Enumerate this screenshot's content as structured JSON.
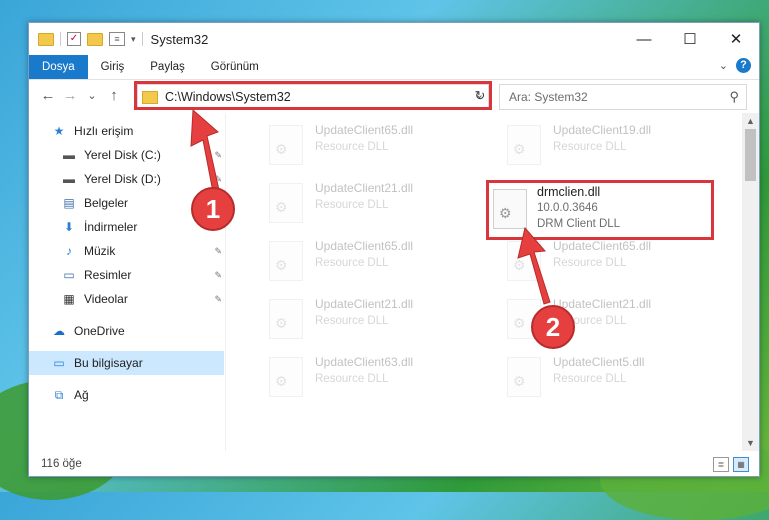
{
  "window": {
    "title": "System32"
  },
  "window_controls": {
    "minimize": "—",
    "maximize": "☐",
    "close": "✕"
  },
  "ribbon": {
    "tabs": [
      "Dosya",
      "Giriş",
      "Paylaş",
      "Görünüm"
    ],
    "active_tab": "Dosya",
    "help": "?"
  },
  "navigation": {
    "back": "←",
    "forward": "→",
    "recent": "⌄",
    "up": "↑",
    "address": "C:\\Windows\\System32",
    "refresh": "↻",
    "search_placeholder": "Ara: System32"
  },
  "sidebar": {
    "items": [
      {
        "label": "Hızlı erişim",
        "icon": "star-icon",
        "glyph": "★",
        "color": "#2b7fd4",
        "pinned": false,
        "selected": false
      },
      {
        "label": "Yerel Disk (C:)",
        "icon": "drive-icon",
        "glyph": "▬",
        "color": "#555555",
        "pinned": true,
        "selected": false
      },
      {
        "label": "Yerel Disk (D:)",
        "icon": "drive-icon",
        "glyph": "▬",
        "color": "#555555",
        "pinned": true,
        "selected": false
      },
      {
        "label": "Belgeler",
        "icon": "documents-icon",
        "glyph": "▤",
        "color": "#3a6ea5",
        "pinned": true,
        "selected": false
      },
      {
        "label": "İndirmeler",
        "icon": "downloads-icon",
        "glyph": "⬇",
        "color": "#2b7fd4",
        "pinned": true,
        "selected": false
      },
      {
        "label": "Müzik",
        "icon": "music-icon",
        "glyph": "♪",
        "color": "#2b7fd4",
        "pinned": true,
        "selected": false
      },
      {
        "label": "Resimler",
        "icon": "pictures-icon",
        "glyph": "▭",
        "color": "#3a6ea5",
        "pinned": true,
        "selected": false
      },
      {
        "label": "Videolar",
        "icon": "videos-icon",
        "glyph": "▦",
        "color": "#333333",
        "pinned": true,
        "selected": false
      },
      {
        "label": "OneDrive",
        "icon": "onedrive-icon",
        "glyph": "☁",
        "color": "#1a6fc9",
        "pinned": false,
        "selected": false
      },
      {
        "label": "Bu bilgisayar",
        "icon": "computer-icon",
        "glyph": "▭",
        "color": "#2b7fd4",
        "pinned": false,
        "selected": true
      },
      {
        "label": "Ağ",
        "icon": "network-icon",
        "glyph": "⧉",
        "color": "#2b7fd4",
        "pinned": false,
        "selected": false
      }
    ],
    "pin_glyph": "📌"
  },
  "files": [
    {
      "name": "UpdateClient65.dll",
      "desc": "Resource DLL",
      "faded": true
    },
    {
      "name": "UpdateClient19.dll",
      "desc": "Resource DLL",
      "faded": true
    },
    {
      "name": "UpdateClient21.dll",
      "desc": "Resource DLL",
      "faded": true
    },
    {
      "name": "drmclien.dll",
      "version": "10.0.0.3646",
      "desc": "DRM Client DLL",
      "faded": false
    },
    {
      "name": "UpdateClient65.dll",
      "desc": "Resource DLL",
      "faded": true
    },
    {
      "name": "UpdateClient65.dll",
      "desc": "Resource DLL",
      "faded": true
    },
    {
      "name": "UpdateClient21.dll",
      "desc": "Resource DLL",
      "faded": true
    },
    {
      "name": "UpdateClient21.dll",
      "desc": "Resource DLL",
      "faded": true
    },
    {
      "name": "UpdateClient63.dll",
      "desc": "Resource DLL",
      "faded": true
    },
    {
      "name": "UpdateClient5.dll",
      "desc": "Resource DLL",
      "faded": true
    }
  ],
  "status": {
    "count": "116 öğe"
  },
  "annotations": {
    "step1": "1",
    "step2": "2",
    "color": "#e5403f"
  }
}
